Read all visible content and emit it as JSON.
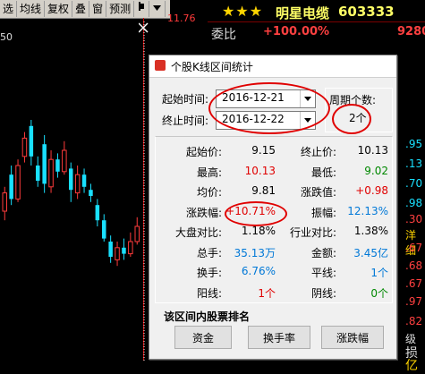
{
  "toolbar": {
    "items": [
      "选",
      "均线",
      "复权",
      "叠",
      "窗",
      "预测"
    ],
    "pin_icon": "pin-icon",
    "dropdown_icon": "triangle-down-icon"
  },
  "chart": {
    "price_label": "11.76",
    "y_tick": "50"
  },
  "stock": {
    "stars": "★★★",
    "name": "明星电缆",
    "code": "603333",
    "weibi_label": "委比",
    "weibi_value": "+100.00%",
    "weibi_right": "9280",
    "right_values": [
      ".95",
      ".13",
      ".70",
      ".98",
      ".30",
      "洋细",
      ".67",
      ".68",
      ".67",
      ".97",
      ".82",
      "级",
      "损",
      "亿"
    ]
  },
  "dialog": {
    "title": "个股K线区间统计",
    "start_time_label": "起始时间:",
    "start_time_value": "2016-12-21",
    "end_time_label": "终止时间:",
    "end_time_value": "2016-12-22",
    "period_label": "周期个数:",
    "period_value": "2个",
    "stats": [
      {
        "label": "起始价:",
        "value": "9.15",
        "color": "blk",
        "label2": "终止价:",
        "value2": "10.13",
        "color2": "blk"
      },
      {
        "label": "最高:",
        "value": "10.13",
        "color": "red",
        "label2": "最低:",
        "value2": "9.02",
        "color2": "grn"
      },
      {
        "label": "均价:",
        "value": "9.81",
        "color": "blk",
        "label2": "涨跌值:",
        "value2": "+0.98",
        "color2": "red"
      },
      {
        "label": "涨跌幅:",
        "value": "+10.71%",
        "color": "red",
        "label2": "振幅:",
        "value2": "12.13%",
        "color2": "blu"
      },
      {
        "label": "大盘对比:",
        "value": "1.18%",
        "color": "blk",
        "label2": "行业对比:",
        "value2": "1.38%",
        "color2": "blk"
      },
      {
        "label": "总手:",
        "value": "35.13万",
        "color": "blu",
        "label2": "金额:",
        "value2": "3.45亿",
        "color2": "blu"
      },
      {
        "label": "换手:",
        "value": "6.76%",
        "color": "blu",
        "label2": "平线:",
        "value2": "1个",
        "color2": "blu"
      },
      {
        "label": "阳线:",
        "value": "1个",
        "color": "red",
        "label2": "阴线:",
        "value2": "0个",
        "color2": "grn"
      }
    ],
    "rank_label": "该区间内股票排名",
    "buttons": [
      "资金",
      "换手率",
      "涨跌幅"
    ]
  },
  "colors": {
    "up": "#ff3b3b",
    "down": "#19e0ff",
    "dialog_bg": "#f0f0f0",
    "annotation_ring": "#e00000"
  },
  "candles": [
    {
      "o": 0.4,
      "c": 0.46,
      "h": 0.48,
      "l": 0.37
    },
    {
      "o": 0.52,
      "c": 0.44,
      "h": 0.55,
      "l": 0.42
    },
    {
      "o": 0.44,
      "c": 0.55,
      "h": 0.57,
      "l": 0.43
    },
    {
      "o": 0.58,
      "c": 0.64,
      "h": 0.66,
      "l": 0.56
    },
    {
      "o": 0.68,
      "c": 0.58,
      "h": 0.7,
      "l": 0.55
    },
    {
      "o": 0.55,
      "c": 0.5,
      "h": 0.58,
      "l": 0.48
    },
    {
      "o": 0.62,
      "c": 0.49,
      "h": 0.65,
      "l": 0.46
    },
    {
      "o": 0.48,
      "c": 0.57,
      "h": 0.6,
      "l": 0.46
    },
    {
      "o": 0.57,
      "c": 0.53,
      "h": 0.59,
      "l": 0.51
    },
    {
      "o": 0.53,
      "c": 0.6,
      "h": 0.63,
      "l": 0.52
    },
    {
      "o": 0.54,
      "c": 0.47,
      "h": 0.56,
      "l": 0.43
    },
    {
      "o": 0.46,
      "c": 0.52,
      "h": 0.55,
      "l": 0.44
    },
    {
      "o": 0.52,
      "c": 0.48,
      "h": 0.54,
      "l": 0.46
    },
    {
      "o": 0.47,
      "c": 0.45,
      "h": 0.49,
      "l": 0.43
    },
    {
      "o": 0.42,
      "c": 0.37,
      "h": 0.44,
      "l": 0.35
    },
    {
      "o": 0.37,
      "c": 0.31,
      "h": 0.39,
      "l": 0.3
    },
    {
      "o": 0.3,
      "c": 0.25,
      "h": 0.32,
      "l": 0.23
    },
    {
      "o": 0.24,
      "c": 0.28,
      "h": 0.3,
      "l": 0.22
    },
    {
      "o": 0.28,
      "c": 0.26,
      "h": 0.31,
      "l": 0.24
    },
    {
      "o": 0.26,
      "c": 0.3,
      "h": 0.33,
      "l": 0.25
    },
    {
      "o": 0.3,
      "c": 0.35,
      "h": 0.38,
      "l": 0.29
    }
  ]
}
